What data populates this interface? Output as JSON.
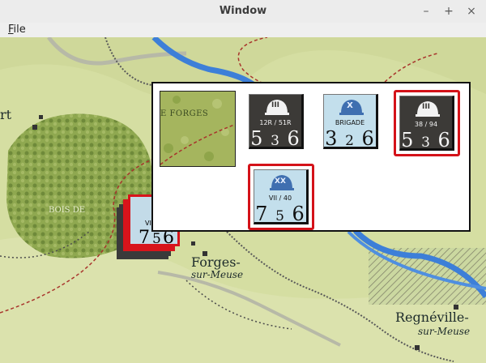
{
  "window": {
    "title": "Window",
    "minimize": "–",
    "maximize": "+",
    "close": "×"
  },
  "menu": {
    "file": "File"
  },
  "map": {
    "labels": {
      "rt": "rt",
      "bois_de": "BOIS DE",
      "forges": "Forges-",
      "forges_sub": "sur-Meuse",
      "regneville": "Regnéville-",
      "regneville_sub": "sur-Meuse"
    },
    "stack_counter": {
      "unit_id": "VI",
      "factors": [
        "7",
        "5",
        "6"
      ]
    }
  },
  "popup": {
    "terrain_label": "E FORGES",
    "counters": [
      {
        "kind": "dark",
        "echelon": "III",
        "unit_id": "12R / 51R",
        "factors": [
          "5",
          "3",
          "6"
        ],
        "selected": false
      },
      {
        "kind": "light",
        "echelon": "X",
        "unit_id": "BRIGADE",
        "factors": [
          "3",
          "2",
          "6"
        ],
        "selected": false
      },
      {
        "kind": "dark",
        "echelon": "III",
        "unit_id": "38 / 94",
        "factors": [
          "5",
          "3",
          "6"
        ],
        "selected": true
      },
      {
        "kind": "light",
        "echelon": "XX",
        "unit_id": "VII / 40",
        "factors": [
          "7",
          "5",
          "6"
        ],
        "selected": true
      }
    ]
  },
  "colors": {
    "selection": "#d41219",
    "dark_counter": "#3c3a37",
    "light_counter": "#c3dfec",
    "river": "#3d7fd8"
  }
}
